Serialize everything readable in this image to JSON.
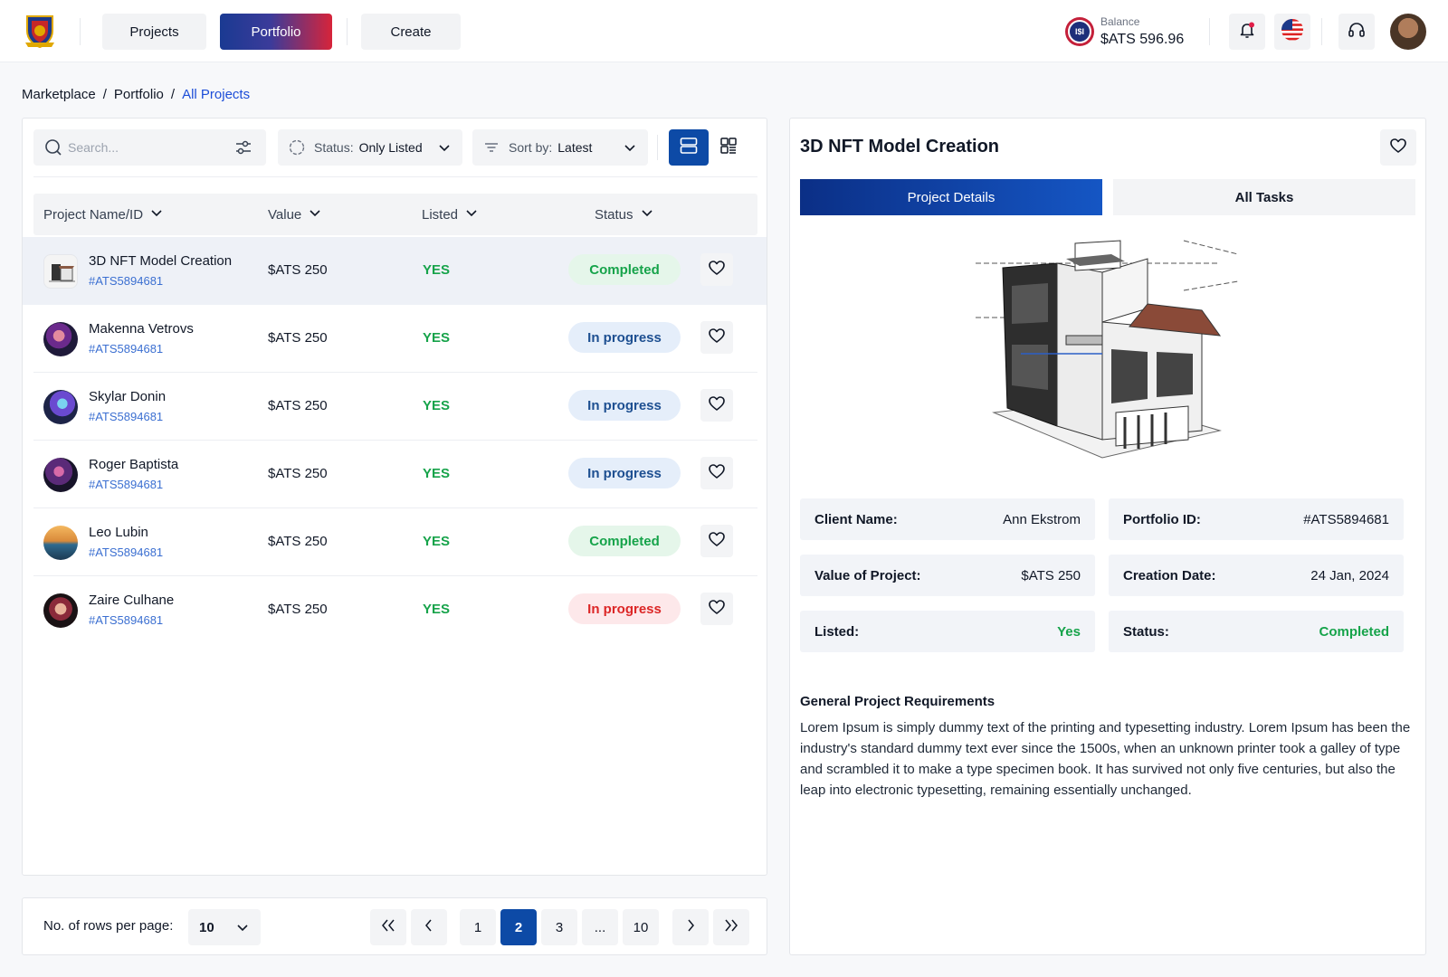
{
  "nav": {
    "projects": "Projects",
    "portfolio": "Portfolio",
    "create": "Create"
  },
  "balance": {
    "label": "Balance",
    "value": "$ATS 596.96",
    "coin_text": "I$I"
  },
  "breadcrumb": {
    "marketplace": "Marketplace",
    "portfolio": "Portfolio",
    "current": "All Projects",
    "sep": "/"
  },
  "toolbar": {
    "search_placeholder": "Search...",
    "status_label": "Status:",
    "status_value": "Only Listed",
    "sort_label": "Sort by:",
    "sort_value": "Latest"
  },
  "table": {
    "columns": [
      "Project Name/ID",
      "Value",
      "Listed",
      "Status"
    ],
    "rows": [
      {
        "name": "3D NFT Model Creation",
        "id": "#ATS5894681",
        "value": "$ATS 250",
        "listed": "YES",
        "status": "Completed",
        "tone": "done"
      },
      {
        "name": "Makenna Vetrovs",
        "id": "#ATS5894681",
        "value": "$ATS 250",
        "listed": "YES",
        "status": "In progress",
        "tone": "prog"
      },
      {
        "name": "Skylar Donin",
        "id": "#ATS5894681",
        "value": "$ATS 250",
        "listed": "YES",
        "status": "In progress",
        "tone": "prog"
      },
      {
        "name": "Roger Baptista",
        "id": "#ATS5894681",
        "value": "$ATS 250",
        "listed": "YES",
        "status": "In progress",
        "tone": "prog"
      },
      {
        "name": "Leo Lubin",
        "id": "#ATS5894681",
        "value": "$ATS 250",
        "listed": "YES",
        "status": "Completed",
        "tone": "done"
      },
      {
        "name": "Zaire Culhane",
        "id": "#ATS5894681",
        "value": "$ATS 250",
        "listed": "YES",
        "status": "In progress",
        "tone": "late"
      }
    ]
  },
  "pagination": {
    "rows_label": "No. of rows per page:",
    "rows_value": "10",
    "pages": [
      "1",
      "2",
      "3",
      "...",
      "10"
    ],
    "current": "2"
  },
  "detail": {
    "title": "3D NFT Model Creation",
    "tab_details": "Project Details",
    "tab_tasks": "All Tasks",
    "client_label": "Client Name:",
    "client_value": "Ann Ekstrom",
    "portfolio_label": "Portfolio ID:",
    "portfolio_value": "#ATS5894681",
    "value_label": "Value of Project:",
    "value_value": "$ATS 250",
    "date_label": "Creation Date:",
    "date_value": "24 Jan, 2024",
    "listed_label": "Listed:",
    "listed_value": "Yes",
    "status_label": "Status:",
    "status_value": "Completed",
    "req_title": "General Project Requirements",
    "req_text": "Lorem Ipsum is simply dummy text of the printing and typesetting industry. Lorem Ipsum has been the industry's standard dummy text ever since the 1500s, when an unknown printer took a galley of type and scrambled it to make a type specimen book. It has survived not only five centuries, but also the leap into electronic typesetting, remaining essentially unchanged."
  },
  "colors": {
    "accent_blue": "#0d4aa6",
    "success_green": "#16a34a",
    "danger_red": "#dc2626",
    "progress_blue": "#1d4f91"
  },
  "icons": [
    "logo-emblem",
    "bell-icon",
    "us-flag-icon",
    "headset-icon",
    "search-icon",
    "filter-sliders-icon",
    "status-circle-icon",
    "sort-lines-icon",
    "list-view-icon",
    "grid-view-icon",
    "heart-icon",
    "chevron-down-icon"
  ]
}
